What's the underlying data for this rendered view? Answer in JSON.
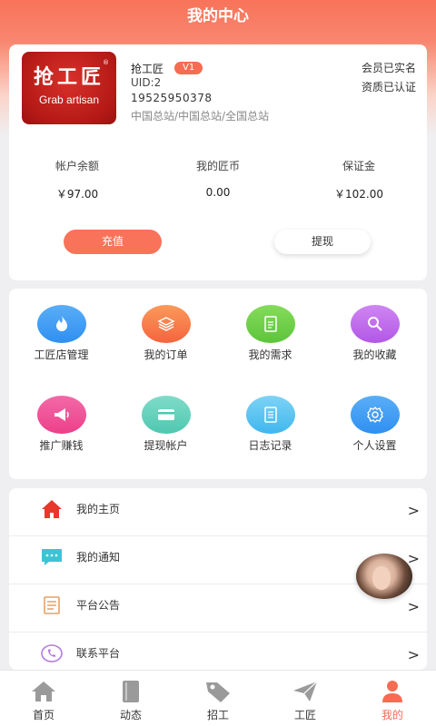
{
  "header": {
    "title": "我的中心"
  },
  "profile": {
    "logo_cn": "抢工匠",
    "logo_en": "Grab artisan",
    "logo_reg": "®",
    "name": "抢工匠",
    "level": "V1",
    "uid": "UID:2",
    "phone": "19525950378",
    "station": "中国总站/中国总站/全国总站",
    "member_status": "会员已实名",
    "qualification_status": "资质已认证"
  },
  "stats": [
    {
      "label": "帐户余额",
      "value": "￥97.00"
    },
    {
      "label": "我的匠币",
      "value": "0.00"
    },
    {
      "label": "保证金",
      "value": "￥102.00"
    }
  ],
  "actions": {
    "recharge": "充值",
    "withdraw": "提现"
  },
  "grid": [
    {
      "label": "工匠店管理",
      "icon": "fire-icon",
      "color": "#2f8ff0"
    },
    {
      "label": "我的订单",
      "icon": "layers-icon",
      "color": "#f5643e"
    },
    {
      "label": "我的需求",
      "icon": "document-icon",
      "color": "#5cc53a"
    },
    {
      "label": "我的收藏",
      "icon": "search-icon",
      "color": "#b257e6"
    },
    {
      "label": "推广赚钱",
      "icon": "megaphone-icon",
      "color": "#ec3f8a"
    },
    {
      "label": "提现帐户",
      "icon": "card-icon",
      "color": "#4fc7b0"
    },
    {
      "label": "日志记录",
      "icon": "log-icon",
      "color": "#3fb7ee"
    },
    {
      "label": "个人设置",
      "icon": "gear-icon",
      "color": "#2f8ff0"
    }
  ],
  "menu": [
    {
      "label": "我的主页",
      "icon": "home-icon",
      "color": "#e8382c"
    },
    {
      "label": "我的通知",
      "icon": "message-icon",
      "color": "#3ec3d6"
    },
    {
      "label": "平台公告",
      "icon": "notice-icon",
      "color": "#e8a063"
    },
    {
      "label": "联系平台",
      "icon": "phone-icon",
      "color": "#b67ae0"
    }
  ],
  "chevron": ">",
  "tabs": [
    {
      "label": "首页",
      "icon": "home-icon"
    },
    {
      "label": "动态",
      "icon": "book-icon"
    },
    {
      "label": "招工",
      "icon": "tag-icon"
    },
    {
      "label": "工匠",
      "icon": "send-icon"
    },
    {
      "label": "我的",
      "icon": "user-icon",
      "active": true
    }
  ],
  "colors": {
    "brand": "#f8735a",
    "tab_active": "#f56c52",
    "tab_inactive": "#9a9a9a"
  }
}
